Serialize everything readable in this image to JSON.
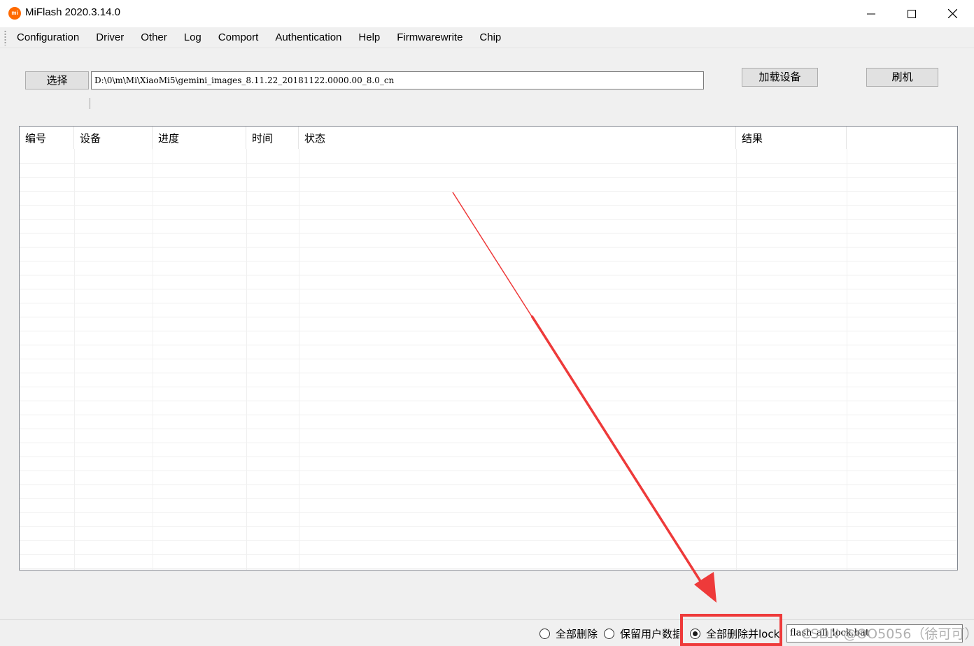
{
  "window": {
    "title": "MiFlash 2020.3.14.0",
    "icon_text": "mi"
  },
  "menu": {
    "items": [
      "Configuration",
      "Driver",
      "Other",
      "Log",
      "Comport",
      "Authentication",
      "Help",
      "Firmwarewrite",
      "Chip"
    ]
  },
  "toolbar": {
    "select_label": "选择",
    "path_value": "D:\\0\\m\\Mi\\XiaoMi5\\gemini_images_8.11.22_20181122.0000.00_8.0_cn",
    "load_device_label": "加载设备",
    "flash_label": "刷机"
  },
  "grid": {
    "columns": [
      "编号",
      "设备",
      "进度",
      "时间",
      "状态",
      "结果"
    ]
  },
  "footer": {
    "radio_options": [
      "全部删除",
      "保留用户数据",
      "全部删除并lock"
    ],
    "selected_option": "全部删除并lock",
    "script_value": "flash_all_lock.bat",
    "watermark": "CSDN @OO5056（徐可可）"
  },
  "colors": {
    "annotation_red": "#ee3a3a",
    "brand_orange": "#ff6900"
  }
}
